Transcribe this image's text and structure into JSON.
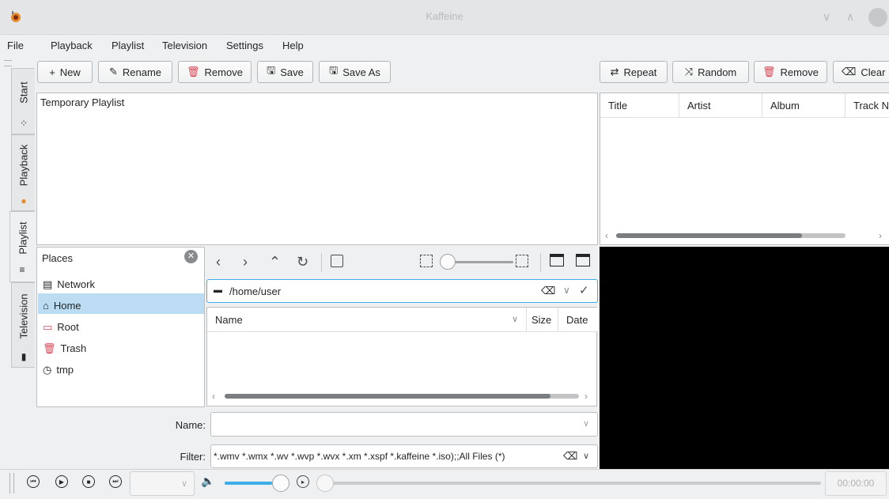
{
  "window": {
    "title": "Kaffeine"
  },
  "menu": [
    "File",
    "Playback",
    "Playlist",
    "Television",
    "Settings",
    "Help"
  ],
  "playlist_toolbar": {
    "new": "New",
    "rename": "Rename",
    "remove": "Remove",
    "save": "Save",
    "save_as": "Save As"
  },
  "track_toolbar": {
    "repeat": "Repeat",
    "random": "Random",
    "remove": "Remove",
    "clear": "Clear"
  },
  "side_tabs": [
    "Start",
    "Playback",
    "Playlist",
    "Television"
  ],
  "playlists": [
    "Temporary Playlist"
  ],
  "track_columns": [
    "Title",
    "Artist",
    "Album",
    "Track Nu"
  ],
  "places": {
    "title": "Places",
    "items": [
      {
        "label": "Network",
        "icon": "network-icon"
      },
      {
        "label": "Home",
        "icon": "home-icon",
        "selected": true
      },
      {
        "label": "Root",
        "icon": "folder-red-icon"
      },
      {
        "label": "Trash",
        "icon": "trash-icon"
      },
      {
        "label": "tmp",
        "icon": "clock-icon"
      }
    ]
  },
  "file_browser": {
    "path": "/home/user",
    "columns": [
      "Name",
      "Size",
      "Date"
    ]
  },
  "name_field": {
    "label": "Name:",
    "value": ""
  },
  "filter_field": {
    "label": "Filter:",
    "value": "*.wmv *.wmx *.wv *.wvp *.wvx *.xm *.xspf *.kaffeine *.iso);;All Files (*)"
  },
  "player": {
    "time": "00:00:00",
    "volume_fraction": 0.85
  },
  "colors": {
    "accent": "#3daee9",
    "selection": "#bcdcf3",
    "remove_red": "#da4453"
  }
}
